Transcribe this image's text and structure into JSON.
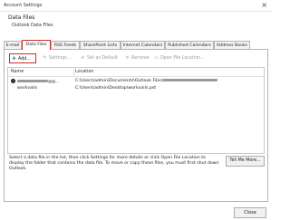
{
  "window": {
    "title": "Account Settings",
    "close_glyph": "×"
  },
  "header": {
    "title": "Data Files",
    "subtitle": "Outlook Data Files"
  },
  "tabs": [
    {
      "label": "E-mail",
      "active": false
    },
    {
      "label": "Data Files",
      "active": true
    },
    {
      "label": "RSS Feeds",
      "active": false
    },
    {
      "label": "SharePoint Lists",
      "active": false
    },
    {
      "label": "Internet Calendars",
      "active": false
    },
    {
      "label": "Published Calendars",
      "active": false
    },
    {
      "label": "Address Books",
      "active": false
    }
  ],
  "toolbar": {
    "add": {
      "label": "Add...",
      "icon": "add-icon"
    },
    "settings": {
      "label": "Settings...",
      "icon": "settings-icon"
    },
    "set_default": {
      "label": "Set as Default",
      "icon": "check-icon"
    },
    "remove": {
      "label": "Remove",
      "icon": "remove-x-icon"
    },
    "open_location": {
      "label": "Open File Location...",
      "icon": "folder-icon"
    }
  },
  "list": {
    "columns": [
      "Name",
      "Location"
    ],
    "rows": [
      {
        "name_suffix": "@g...",
        "location_prefix": "C:\\Users\\admin\\Documents\\Outlook Files\\",
        "default": true
      },
      {
        "name": "workvails",
        "location": "C:\\Users\\admin\\Desktop\\workvails.pst",
        "default": false
      }
    ]
  },
  "help_text": "Select a data file in the list, then click Settings for more details or click Open File Location to display the folder that contains the data file. To move or copy these files, you must first shut down Outlook.",
  "buttons": {
    "tell_me_more": "Tell Me More...",
    "close": "Close"
  },
  "colors": {
    "highlight_red": "#cc2a2a",
    "disabled_text": "#9a9a9a"
  }
}
